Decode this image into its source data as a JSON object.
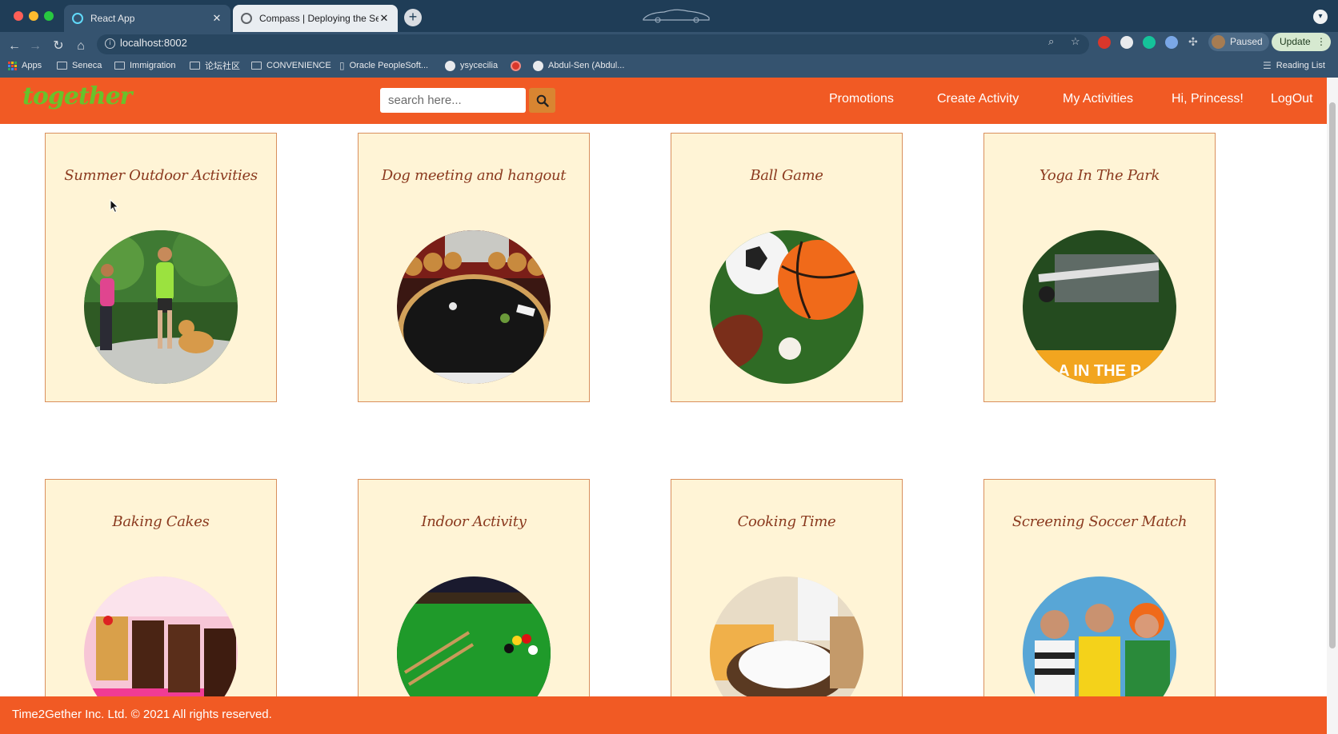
{
  "browser": {
    "tabs": [
      {
        "label": "React App",
        "active": true
      },
      {
        "label": "Compass | Deploying the Serve",
        "active": false
      }
    ],
    "url": "localhost:8002",
    "profile_status": "Paused",
    "update_label": "Update",
    "bookmarks": [
      {
        "label": "Apps",
        "icon": "apps-grid-icon"
      },
      {
        "label": "Seneca",
        "icon": "folder-icon"
      },
      {
        "label": "Immigration",
        "icon": "folder-icon"
      },
      {
        "label": "论坛社区",
        "icon": "folder-icon"
      },
      {
        "label": "CONVENIENCE",
        "icon": "folder-icon"
      },
      {
        "label": "Oracle PeopleSoft...",
        "icon": "page-icon"
      },
      {
        "label": "ysycecilia",
        "icon": "github-icon"
      },
      {
        "label": "",
        "icon": "red-circle-icon"
      },
      {
        "label": "Abdul-Sen (Abdul...",
        "icon": "github-icon"
      }
    ],
    "reading_list": "Reading List"
  },
  "site": {
    "logo": "together",
    "search_placeholder": "search here...",
    "nav": {
      "promotions": "Promotions",
      "create_activity": "Create Activity",
      "my_activities": "My Activities",
      "greeting": "Hi, Princess!",
      "logout": "LogOut"
    },
    "cards": [
      {
        "title": "Summer Outdoor Activities"
      },
      {
        "title": "Dog meeting and hangout"
      },
      {
        "title": "Ball Game"
      },
      {
        "title": "Yoga In The Park"
      },
      {
        "title": "Baking Cakes"
      },
      {
        "title": "Indoor Activity"
      },
      {
        "title": "Cooking Time"
      },
      {
        "title": "Screening Soccer Match"
      }
    ],
    "yoga_banner_text": "A IN THE P",
    "footer": "Time2Gether Inc. Ltd. © 2021 All rights reserved."
  },
  "colors": {
    "brand_orange": "#f15a24",
    "logo_green": "#69c22b",
    "card_bg": "#fff4d6",
    "card_title": "#8b3a1f",
    "search_button": "#d98531"
  }
}
